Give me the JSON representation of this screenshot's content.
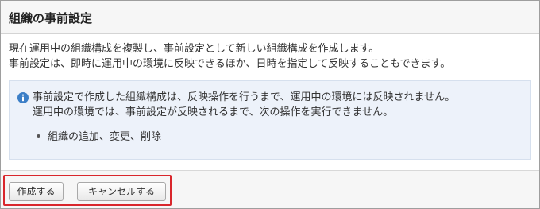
{
  "dialog": {
    "title": "組織の事前設定",
    "description": [
      "現在運用中の組織構成を複製し、事前設定として新しい組織構成を作成します。",
      "事前設定は、即時に運用中の環境に反映できるほか、日時を指定して反映することもできます。"
    ]
  },
  "info": {
    "icon": "info-icon",
    "lines": [
      "事前設定で作成した組織構成は、反映操作を行うまで、運用中の環境には反映されません。",
      "運用中の環境では、事前設定が反映されるまで、次の操作を実行できません。"
    ],
    "bullets": [
      "組織の追加、変更、削除"
    ]
  },
  "buttons": {
    "create_label": "作成する",
    "cancel_label": "キャンセルする"
  },
  "colors": {
    "highlight_border": "#d9262c",
    "info_background": "#edf2fa",
    "info_icon": "#3c7fc7"
  }
}
